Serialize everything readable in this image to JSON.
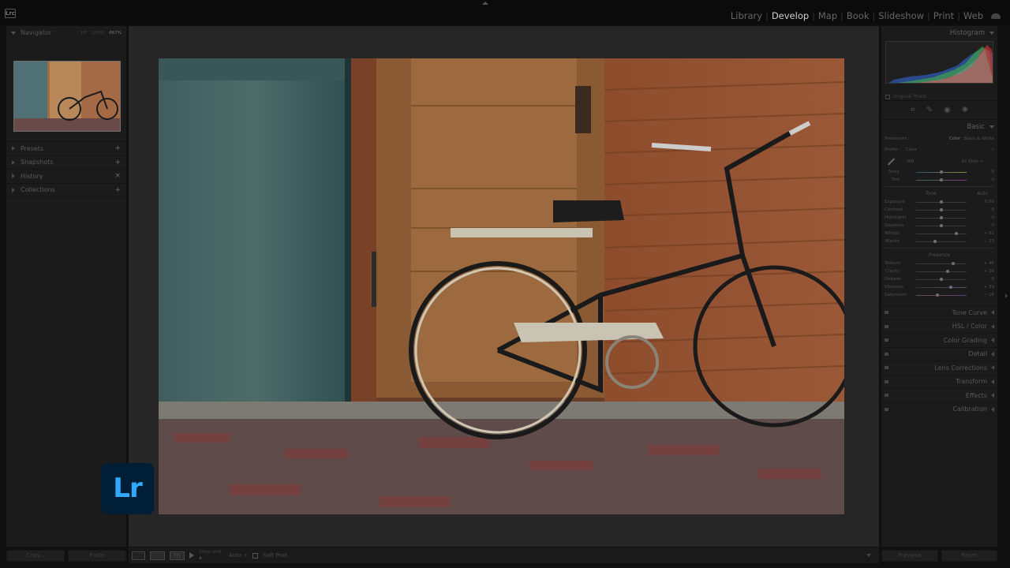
{
  "app": {
    "logo_text": "Lr",
    "mini_logo_text": "Lrc"
  },
  "modules": [
    {
      "label": "Library",
      "active": false
    },
    {
      "label": "Develop",
      "active": true
    },
    {
      "label": "Map",
      "active": false
    },
    {
      "label": "Book",
      "active": false
    },
    {
      "label": "Slideshow",
      "active": false
    },
    {
      "label": "Print",
      "active": false
    },
    {
      "label": "Web",
      "active": false
    }
  ],
  "left_panel": {
    "navigator": {
      "title": "Navigator",
      "zoom_options": [
        "FIT",
        "100%",
        "667%"
      ],
      "active_zoom": "667%"
    },
    "sections": [
      {
        "label": "Presets",
        "action": "+"
      },
      {
        "label": "Snapshots",
        "action": "+"
      },
      {
        "label": "History",
        "action": "×"
      },
      {
        "label": "Collections",
        "action": "+"
      }
    ],
    "copy_label": "Copy...",
    "paste_label": "Paste"
  },
  "toolbar": {
    "view_label": "Y|Y",
    "show_grid_label": "Show Grid :",
    "show_grid_value": "Auto ÷",
    "soft_proof_label": "Soft Proo"
  },
  "right_panel": {
    "histogram_title": "Histogram",
    "original_photo_label": "Original Photo",
    "tool_icons": [
      "crop-icon",
      "heal-icon",
      "redeye-icon",
      "mask-icon"
    ],
    "basic": {
      "title": "Basic",
      "treatment_label": "Treatment :",
      "treatment_options": [
        "Color",
        "Black & White"
      ],
      "profile_label": "Profile :",
      "profile_value": "Color",
      "wb_label": "WB :",
      "wb_value": "As Shot ÷",
      "temp": {
        "label": "Temp",
        "value": "0",
        "pos": 0.5
      },
      "tint": {
        "label": "Tint",
        "value": "0",
        "pos": 0.5
      },
      "tone_title": "Tone",
      "auto_label": "Auto",
      "tone_sliders": [
        {
          "label": "Exposure",
          "value": "0.00",
          "pos": 0.5
        },
        {
          "label": "Contrast",
          "value": "0",
          "pos": 0.5
        },
        {
          "label": "Highlights",
          "value": "0",
          "pos": 0.5
        },
        {
          "label": "Shadows",
          "value": "0",
          "pos": 0.5
        },
        {
          "label": "Whites",
          "value": "+ 61",
          "pos": 0.8
        },
        {
          "label": "Blacks",
          "value": "− 23",
          "pos": 0.38
        }
      ],
      "presence_title": "Presence",
      "presence_sliders": [
        {
          "label": "Texture",
          "value": "+ 46",
          "pos": 0.73
        },
        {
          "label": "Clarity",
          "value": "+ 26",
          "pos": 0.63
        },
        {
          "label": "Dehaze",
          "value": "0",
          "pos": 0.5
        },
        {
          "label": "Vibrance",
          "value": "+ 39",
          "pos": 0.69
        },
        {
          "label": "Saturation",
          "value": "− 16",
          "pos": 0.42
        }
      ]
    },
    "collapsed_panels": [
      "Tone Curve",
      "HSL / Color",
      "Color Grading",
      "Detail",
      "Lens Corrections",
      "Transform",
      "Effects",
      "Calibration"
    ],
    "previous_label": "Previous",
    "reset_label": "Reset"
  }
}
